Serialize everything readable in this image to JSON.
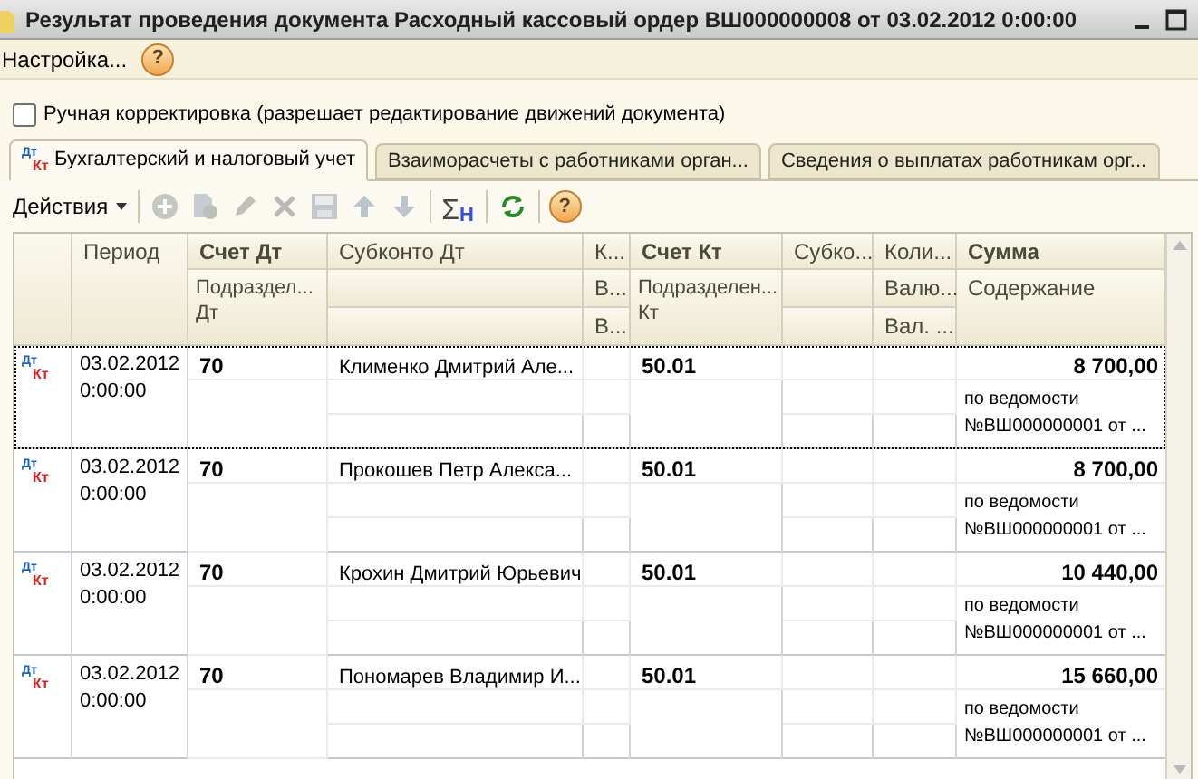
{
  "window": {
    "title": "Результат проведения документа Расходный кассовый ордер ВШ000000008 от 03.02.2012 0:00:00"
  },
  "menu": {
    "settings": "Настройка...",
    "help": "?"
  },
  "manual_edit": {
    "label": "Ручная корректировка (разрешает редактирование движений документа)",
    "checked": false
  },
  "tabs": [
    {
      "label": "Бухгалтерский и налоговый учет",
      "selected": true,
      "icon": {
        "dt": "Дт",
        "kt": "Кт"
      }
    },
    {
      "label": "Взаиморасчеты с работниками орган...",
      "selected": false
    },
    {
      "label": "Сведения о выплатах работникам орг...",
      "selected": false
    }
  ],
  "toolbar": {
    "actions": "Действия",
    "buttons": [
      {
        "kind": "add",
        "disabled": true
      },
      {
        "kind": "copy",
        "disabled": true
      },
      {
        "kind": "edit",
        "disabled": true
      },
      {
        "kind": "delete",
        "disabled": true
      },
      {
        "kind": "save",
        "disabled": true
      },
      {
        "kind": "up",
        "disabled": true
      },
      {
        "kind": "down",
        "disabled": true
      },
      {
        "kind": "separator"
      },
      {
        "kind": "sum",
        "glyph": "Σ",
        "sub": "Н",
        "disabled": false
      },
      {
        "kind": "separator"
      },
      {
        "kind": "refresh",
        "disabled": false
      },
      {
        "kind": "separator"
      },
      {
        "kind": "help",
        "glyph": "?",
        "disabled": false
      }
    ]
  },
  "table": {
    "header": {
      "period": "Период",
      "debit_account": "Счет Дт",
      "debit_subdivision": "Подраздел... Дт",
      "debit_subconto": "Субконто Дт",
      "column_5": [
        "К...",
        "В...",
        "В..."
      ],
      "credit_account": "Счет Кт",
      "credit_subdivision": "Подразделен... Кт",
      "credit_subconto": "Субко...",
      "quantity": [
        "Коли...",
        "Валю...",
        "Вал. ..."
      ],
      "amount": "Сумма",
      "content": "Содержание"
    },
    "rows": [
      {
        "selected": true,
        "icon": {
          "dt": "Дт",
          "kt": "Кт"
        },
        "period": "03.02.2012 0:00:00",
        "debit": "70",
        "subconto": "Клименко Дмитрий Але...",
        "credit": "50.01",
        "amount": "8 700,00",
        "content": "по ведомости №ВШ000000001 от ..."
      },
      {
        "selected": false,
        "icon": {
          "dt": "Дт",
          "kt": "Кт"
        },
        "period": "03.02.2012 0:00:00",
        "debit": "70",
        "subconto": "Прокошев Петр Алекса...",
        "credit": "50.01",
        "amount": "8 700,00",
        "content": "по ведомости №ВШ000000001 от ..."
      },
      {
        "selected": false,
        "icon": {
          "dt": "Дт",
          "kt": "Кт"
        },
        "period": "03.02.2012 0:00:00",
        "debit": "70",
        "subconto": "Крохин Дмитрий Юрьевич",
        "credit": "50.01",
        "amount": "10 440,00",
        "content": "по ведомости №ВШ000000001 от ..."
      },
      {
        "selected": false,
        "icon": {
          "dt": "Дт",
          "kt": "Кт"
        },
        "period": "03.02.2012 0:00:00",
        "debit": "70",
        "subconto": "Пономарев Владимир И...",
        "credit": "50.01",
        "amount": "15 660,00",
        "content": "по ведомости №ВШ000000001 от ..."
      }
    ]
  }
}
